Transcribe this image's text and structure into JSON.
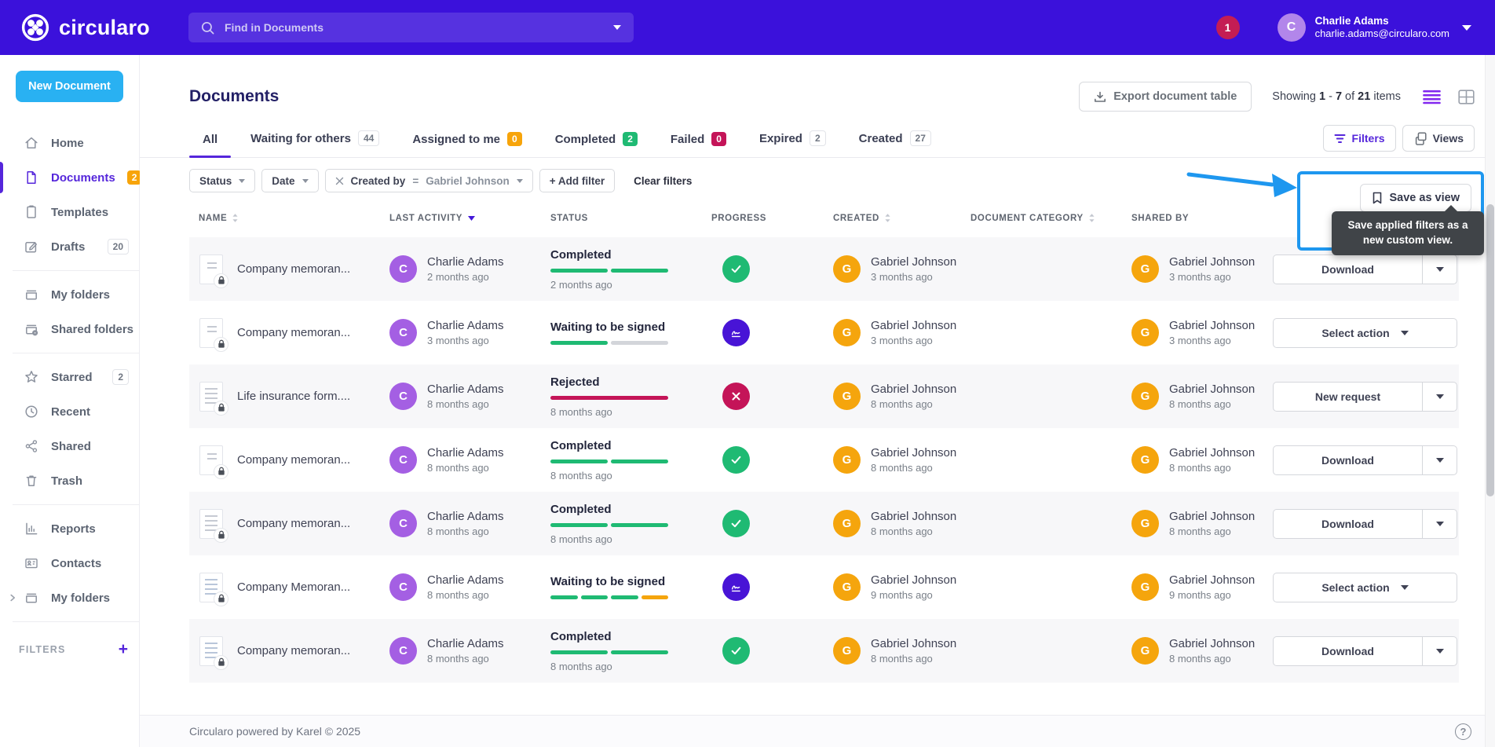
{
  "header": {
    "brand": "circularo",
    "search": {
      "placeholder": "Find in Documents"
    },
    "notification_count": "1",
    "user": {
      "initial": "C",
      "name": "Charlie Adams",
      "email": "charlie.adams@circularo.com"
    }
  },
  "sidebar": {
    "new_document": "New Document",
    "groups": [
      {
        "items": [
          {
            "icon": "home",
            "label": "Home"
          },
          {
            "icon": "document",
            "label": "Documents",
            "active": true,
            "badge": "2",
            "badge_style": "orange"
          },
          {
            "icon": "template",
            "label": "Templates"
          },
          {
            "icon": "drafts",
            "label": "Drafts",
            "badge": "20",
            "badge_style": "outline"
          }
        ]
      },
      {
        "items": [
          {
            "icon": "folder",
            "label": "My folders"
          },
          {
            "icon": "shared-folder",
            "label": "Shared folders"
          }
        ]
      },
      {
        "items": [
          {
            "icon": "star",
            "label": "Starred",
            "badge": "2",
            "badge_style": "outline"
          },
          {
            "icon": "clock",
            "label": "Recent"
          },
          {
            "icon": "share",
            "label": "Shared"
          },
          {
            "icon": "trash",
            "label": "Trash"
          }
        ]
      },
      {
        "items": [
          {
            "icon": "reports",
            "label": "Reports"
          },
          {
            "icon": "contacts",
            "label": "Contacts"
          },
          {
            "icon": "folder",
            "label": "My folders",
            "chevron": true
          }
        ]
      }
    ],
    "filters_label": "FILTERS"
  },
  "page": {
    "title": "Documents",
    "export_button": "Export document table",
    "showing": {
      "label": "Showing",
      "from": "1",
      "dash": "-",
      "to": "7",
      "of": "of",
      "total": "21",
      "items": "items"
    },
    "tabs": [
      {
        "label": "All",
        "active": true
      },
      {
        "label": "Waiting for others",
        "badge": "44",
        "badge_style": "outline"
      },
      {
        "label": "Assigned to me",
        "badge": "0",
        "badge_style": "orange"
      },
      {
        "label": "Completed",
        "badge": "2",
        "badge_style": "green"
      },
      {
        "label": "Failed",
        "badge": "0",
        "badge_style": "crimson"
      },
      {
        "label": "Expired",
        "badge": "2",
        "badge_style": "outline"
      },
      {
        "label": "Created",
        "badge": "27",
        "badge_style": "outline"
      }
    ],
    "filters_button": "Filters",
    "views_button": "Views",
    "chips": {
      "status": "Status",
      "date": "Date",
      "created_by": {
        "field": "Created by",
        "op": "=",
        "value": "Gabriel Johnson"
      },
      "add_filter": "+ Add filter",
      "clear_filters": "Clear filters"
    },
    "save_as_view": {
      "label": "Save as view",
      "tooltip": "Save applied filters as a new custom view."
    }
  },
  "table": {
    "columns": [
      {
        "label": "NAME",
        "sort": "both"
      },
      {
        "label": "LAST ACTIVITY",
        "sort": "desc-active"
      },
      {
        "label": "STATUS",
        "sort": "none"
      },
      {
        "label": "PROGRESS",
        "sort": "none"
      },
      {
        "label": "CREATED",
        "sort": "both"
      },
      {
        "label": "DOCUMENT CATEGORY",
        "sort": "both"
      },
      {
        "label": "SHARED BY",
        "sort": "none"
      },
      {
        "label": "",
        "sort": "none"
      }
    ],
    "rows": [
      {
        "name": "Company memoran...",
        "doc_icon": "doc-memo",
        "last_activity": {
          "initial": "C",
          "name": "Charlie Adams",
          "time": "2 months ago"
        },
        "status": {
          "label": "Completed",
          "time": "2 months ago",
          "segments": [
            "green",
            "green"
          ],
          "icon": "check"
        },
        "created": {
          "initial": "G",
          "name": "Gabriel Johnson",
          "time": "3 months ago"
        },
        "category": "",
        "shared_by": {
          "initial": "G",
          "name": "Gabriel Johnson",
          "time": "3 months ago"
        },
        "action": {
          "label": "Download",
          "split": true
        }
      },
      {
        "name": "Company memoran...",
        "doc_icon": "doc-memo",
        "last_activity": {
          "initial": "C",
          "name": "Charlie Adams",
          "time": "3 months ago"
        },
        "status": {
          "label": "Waiting to be signed",
          "segments": [
            "green",
            "gray"
          ],
          "icon": "sign"
        },
        "created": {
          "initial": "G",
          "name": "Gabriel Johnson",
          "time": "3 months ago"
        },
        "category": "",
        "shared_by": {
          "initial": "G",
          "name": "Gabriel Johnson",
          "time": "3 months ago"
        },
        "action": {
          "label": "Select action",
          "split": false
        }
      },
      {
        "name": "Life insurance form....",
        "doc_icon": "doc-letter",
        "last_activity": {
          "initial": "C",
          "name": "Charlie Adams",
          "time": "8 months ago"
        },
        "status": {
          "label": "Rejected",
          "time": "8 months ago",
          "segments": [
            "red"
          ],
          "icon": "reject"
        },
        "created": {
          "initial": "G",
          "name": "Gabriel Johnson",
          "time": "8 months ago"
        },
        "category": "",
        "shared_by": {
          "initial": "G",
          "name": "Gabriel Johnson",
          "time": "8 months ago"
        },
        "action": {
          "label": "New request",
          "split": true
        }
      },
      {
        "name": "Company memoran...",
        "doc_icon": "doc-memo",
        "last_activity": {
          "initial": "C",
          "name": "Charlie Adams",
          "time": "8 months ago"
        },
        "status": {
          "label": "Completed",
          "time": "8 months ago",
          "segments": [
            "green",
            "green"
          ],
          "icon": "check"
        },
        "created": {
          "initial": "G",
          "name": "Gabriel Johnson",
          "time": "8 months ago"
        },
        "category": "",
        "shared_by": {
          "initial": "G",
          "name": "Gabriel Johnson",
          "time": "8 months ago"
        },
        "action": {
          "label": "Download",
          "split": true
        }
      },
      {
        "name": "Company memoran...",
        "doc_icon": "doc-letter",
        "last_activity": {
          "initial": "C",
          "name": "Charlie Adams",
          "time": "8 months ago"
        },
        "status": {
          "label": "Completed",
          "time": "8 months ago",
          "segments": [
            "green",
            "green"
          ],
          "icon": "check"
        },
        "created": {
          "initial": "G",
          "name": "Gabriel Johnson",
          "time": "8 months ago"
        },
        "category": "",
        "shared_by": {
          "initial": "G",
          "name": "Gabriel Johnson",
          "time": "8 months ago"
        },
        "action": {
          "label": "Download",
          "split": true
        }
      },
      {
        "name": "Company Memoran...",
        "doc_icon": "doc-form",
        "last_activity": {
          "initial": "C",
          "name": "Charlie Adams",
          "time": "8 months ago"
        },
        "status": {
          "label": "Waiting to be signed",
          "segments": [
            "green",
            "green",
            "green",
            "orange"
          ],
          "icon": "sign"
        },
        "created": {
          "initial": "G",
          "name": "Gabriel Johnson",
          "time": "9 months ago"
        },
        "category": "",
        "shared_by": {
          "initial": "G",
          "name": "Gabriel Johnson",
          "time": "9 months ago"
        },
        "action": {
          "label": "Select action",
          "split": false
        }
      },
      {
        "name": "Company memoran...",
        "doc_icon": "doc-form",
        "last_activity": {
          "initial": "C",
          "name": "Charlie Adams",
          "time": "8 months ago"
        },
        "status": {
          "label": "Completed",
          "time": "8 months ago",
          "segments": [
            "green",
            "green"
          ],
          "icon": "check"
        },
        "created": {
          "initial": "G",
          "name": "Gabriel Johnson",
          "time": "8 months ago"
        },
        "category": "",
        "shared_by": {
          "initial": "G",
          "name": "Gabriel Johnson",
          "time": "8 months ago"
        },
        "action": {
          "label": "Download",
          "split": true
        }
      }
    ]
  },
  "footer": {
    "copyright": "Circularo powered by Karel © 2025",
    "help_symbol": "?"
  },
  "colors": {
    "brand_purple": "#3B11DB",
    "accent_purple": "#5526DB",
    "new_document_blue": "#29B1F2",
    "annotation_blue": "#1E97EF",
    "success_green": "#1FBA73",
    "warning_orange": "#F7A40A",
    "danger_crimson": "#C41458",
    "signature_purple": "#4814D6",
    "avatar_purple": "#A45FE3",
    "avatar_orange": "#F5A50D",
    "notification_red": "#C41D54"
  }
}
